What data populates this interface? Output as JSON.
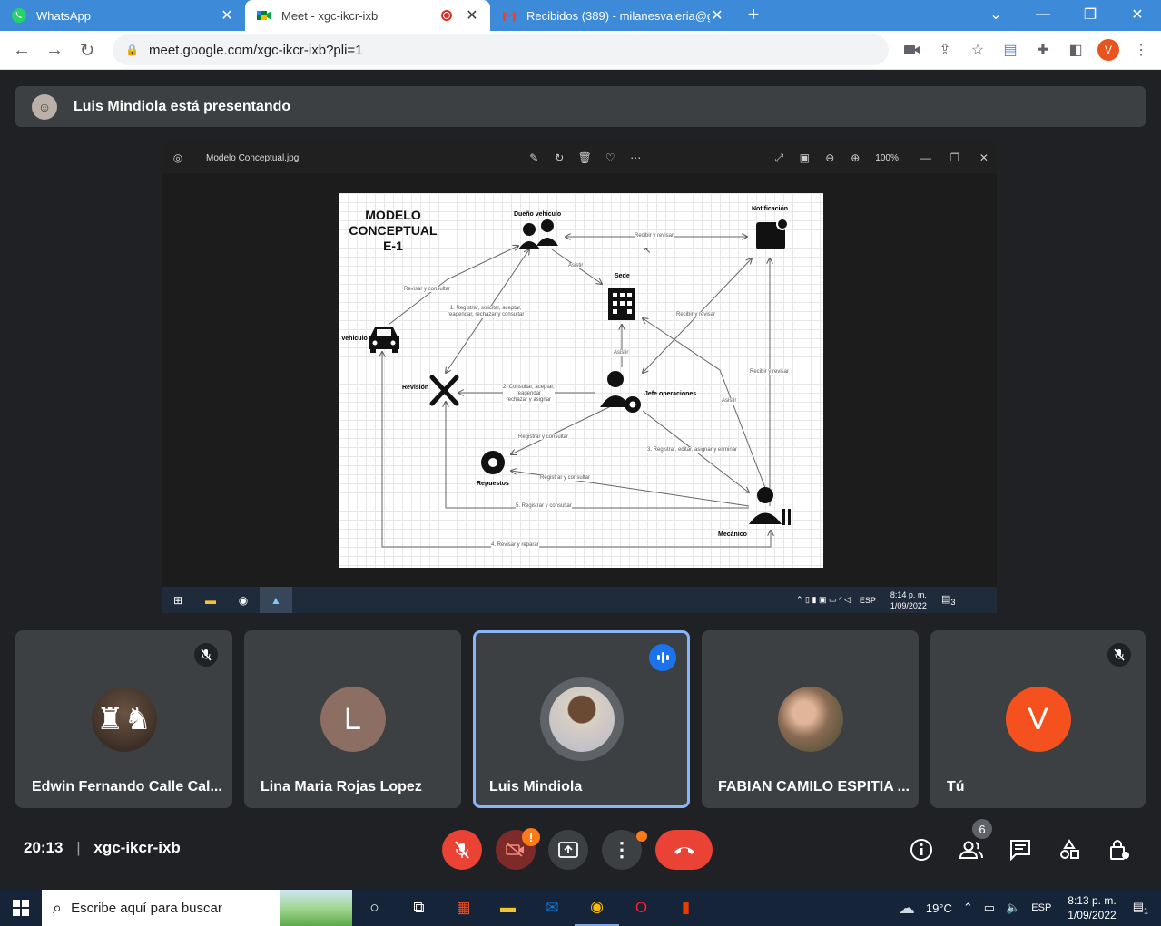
{
  "browser": {
    "tabs": [
      {
        "title": "WhatsApp",
        "icon": "whatsapp-icon",
        "active": false
      },
      {
        "title": "Meet - xgc-ikcr-ixb",
        "icon": "meet-icon",
        "active": true,
        "recording": true
      },
      {
        "title": "Recibidos (389) - milanesvaleria@gm",
        "icon": "gmail-icon",
        "active": false
      }
    ],
    "url": "meet.google.com/xgc-ikcr-ixb?pli=1",
    "profile_initial": "V"
  },
  "meet": {
    "presenting_banner": "Luis Mindiola está presentando",
    "shared_window": {
      "file_name": "Modelo Conceptual.jpg",
      "zoom": "100%",
      "taskbar_time": "8:14 p. m.",
      "taskbar_date": "1/09/2022",
      "taskbar_lang": "ESP",
      "taskbar_notifications": "3"
    },
    "diagram": {
      "title_lines": [
        "MODELO",
        "CONCEPTUAL",
        "E-1"
      ],
      "entities": {
        "owner": "Dueño vehiculo",
        "notification": "Notificación",
        "site": "Sede",
        "vehicle": "Vehiculo",
        "revision": "Revisión",
        "manager": "Jefe operaciones",
        "parts": "Repuestos",
        "mechanic": "Mecánico"
      },
      "relations": {
        "r_receive_top": "Recibir y revisar",
        "r_assist_owner": "Asistir",
        "r_check_query": "Revisar y consultar",
        "r1": [
          "1. Registrar, solicitar, aceptar,",
          "reagendar, rechazar y consultar"
        ],
        "r_receive_mid": "Recibir y revisar",
        "r_assist_mgr": "Asistir",
        "r_receive_right": "Recibir y revisar",
        "r_assist_mech": "Asistir",
        "r2": [
          "2. Consultar, aceptar,",
          "reagendar",
          "rechazar y asignar"
        ],
        "r_parts_mgr": "Registrar y consultar",
        "r3": "3. Registrar, editar, asignar y eliminar",
        "r_parts_mech": "Registrar y consultar",
        "r5": "5. Registrar y consultar",
        "r4": "4. Revisar y reparar"
      }
    },
    "participants": [
      {
        "name": "Edwin Fernando Calle Cal...",
        "avatar_type": "photo",
        "avatar_icon": "chess-pieces-photo",
        "muted": true
      },
      {
        "name": "Lina Maria Rojas Lopez",
        "avatar_type": "initial",
        "initial": "L",
        "color": "#8d6e63",
        "muted": false
      },
      {
        "name": "Luis Mindiola",
        "avatar_type": "photo",
        "avatar_icon": "child-photo",
        "speaking": true
      },
      {
        "name": "FABIAN CAMILO ESPITIA ...",
        "avatar_type": "photo",
        "avatar_icon": "father-son-photo",
        "muted": false
      },
      {
        "name": "Tú",
        "avatar_type": "initial",
        "initial": "V",
        "color": "#f4511e",
        "muted": true
      }
    ],
    "time": "20:13",
    "meeting_code": "xgc-ikcr-ixb",
    "people_count": "6"
  },
  "windows": {
    "search_placeholder": "Escribe aquí para buscar",
    "weather": "19°C",
    "lang": "ESP",
    "time": "8:13 p. m.",
    "date": "1/09/2022",
    "notifications": "1"
  }
}
